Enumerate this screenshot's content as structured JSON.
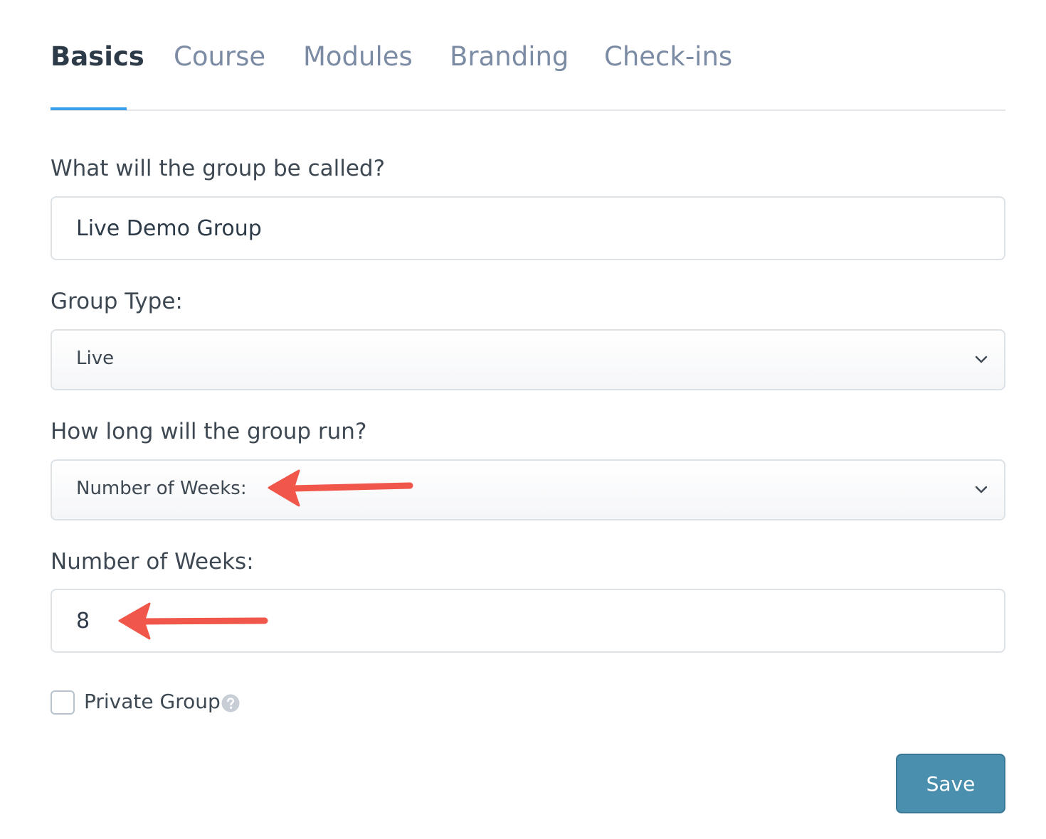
{
  "tabs": [
    {
      "label": "Basics",
      "active": true
    },
    {
      "label": "Course",
      "active": false
    },
    {
      "label": "Modules",
      "active": false
    },
    {
      "label": "Branding",
      "active": false
    },
    {
      "label": "Check-ins",
      "active": false
    }
  ],
  "form": {
    "group_name": {
      "label": "What will the group be called?",
      "value": "Live Demo Group"
    },
    "group_type": {
      "label": "Group Type:",
      "selected": "Live"
    },
    "duration": {
      "label": "How long will the group run?",
      "selected": "Number of Weeks:"
    },
    "weeks": {
      "label": "Number of Weeks:",
      "value": "8"
    },
    "private_group": {
      "label": "Private Group",
      "checked": false,
      "help_icon": "question-circle-icon"
    }
  },
  "actions": {
    "save_label": "Save"
  },
  "colors": {
    "active_tab": "#2d3a48",
    "inactive_tab": "#7a8ba3",
    "tab_underline": "#3a9ee8",
    "save_button": "#4a8fae",
    "annotation_arrow": "#f0574a"
  }
}
